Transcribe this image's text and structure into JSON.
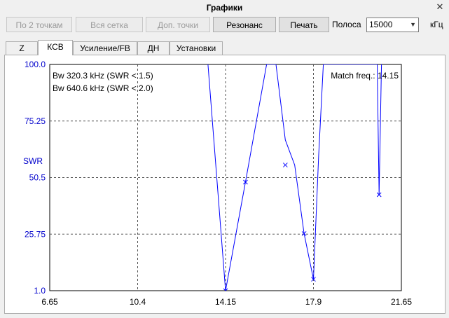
{
  "window": {
    "title": "Графики",
    "close_glyph": "✕"
  },
  "toolbar": {
    "btn_2points": "По 2 точкам",
    "btn_all_grid": "Вся сетка",
    "btn_extra_points": "Доп. точки",
    "btn_resonance": "Резонанс",
    "btn_print": "Печать",
    "band_label": "Полоса",
    "band_value": "15000",
    "band_unit": "кГц"
  },
  "tabs": [
    "Z",
    "КСВ",
    "Усиление/FB",
    "ДН",
    "Установки"
  ],
  "active_tab": "КСВ",
  "chart_data": {
    "type": "line",
    "ylabel": "SWR",
    "xlabel": "",
    "xlim": [
      6.65,
      21.65
    ],
    "ylim": [
      1.0,
      100.0
    ],
    "x_ticks": [
      "6.65",
      "10.4",
      "14.15",
      "17.9",
      "21.65"
    ],
    "y_ticks": [
      "100.0",
      "75.25",
      "50.5",
      "25.75",
      "1.0"
    ],
    "grid": true,
    "annotations": {
      "bw1": "Bw 320.3 kHz (SWR < 1.5)",
      "bw2": "Bw 640.6 kHz (SWR < 2.0)",
      "match": "Match freq.: 14.15"
    },
    "series": [
      {
        "color": "#0000ff",
        "x": [
          13.4,
          14.15,
          15.0,
          15.9,
          16.3,
          16.7,
          17.1,
          17.5,
          17.9,
          18.12,
          18.32,
          20.62,
          20.7,
          20.8
        ],
        "y": [
          100.0,
          1.0,
          48.5,
          100.0,
          100.0,
          67.0,
          56.0,
          26.0,
          6.0,
          60.0,
          100.0,
          100.0,
          43.0,
          100.0
        ]
      }
    ],
    "markers": {
      "x": [
        14.15,
        15.0,
        16.7,
        17.5,
        17.9,
        20.7
      ],
      "y": [
        1.0,
        48.5,
        56.0,
        26.0,
        6.0,
        43.0
      ]
    }
  }
}
